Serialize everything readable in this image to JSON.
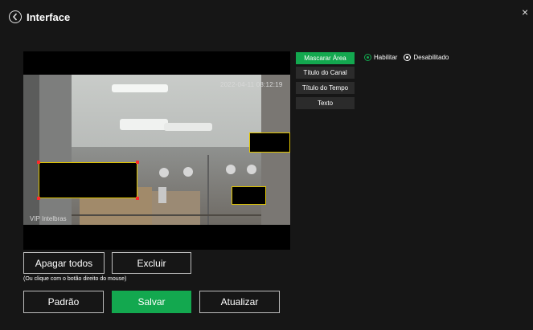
{
  "window": {
    "title": "Interface",
    "close_glyph": "×"
  },
  "video": {
    "timestamp": "2022-04-11 08:12:19",
    "channel_title": "VIP Intelbras"
  },
  "tabs": [
    {
      "label": "Mascarar Área",
      "active": true
    },
    {
      "label": "Título do Canal",
      "active": false
    },
    {
      "label": "Título do Tempo",
      "active": false
    },
    {
      "label": "Texto",
      "active": false
    }
  ],
  "mask_toggle": {
    "options": [
      "Habilitar",
      "Desabilitado"
    ],
    "enable_color": "#13a84f"
  },
  "buttons": {
    "clear_all": "Apagar todos",
    "delete": "Excluir",
    "hint": "(Ou clique com o botão direito do mouse)",
    "default": "Padrão",
    "save": "Salvar",
    "refresh": "Atualizar"
  },
  "colors": {
    "accent": "#13a84f",
    "background": "#161616",
    "mask_border": "#e0c400"
  },
  "icons": {
    "back": "chevron-left-circle-icon",
    "close": "close-icon"
  }
}
